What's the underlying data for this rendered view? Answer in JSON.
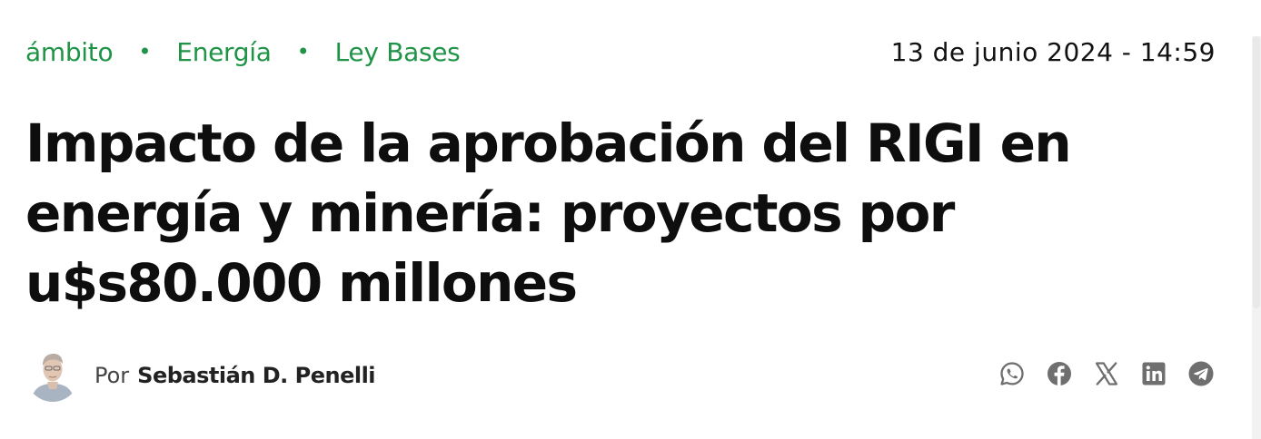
{
  "article": {
    "breadcrumb": [
      {
        "label": "ámbito"
      },
      {
        "label": "Energía"
      },
      {
        "label": "Ley Bases"
      }
    ],
    "breadcrumb_separator": "•",
    "date": "13 de junio 2024 - 14:59",
    "title": "Impacto de la aprobación del RIGI en energía y minería: proyectos por u$s80.000 millones",
    "author_prefix": "Por",
    "author_name": "Sebastián D. Penelli"
  },
  "share": {
    "icons": [
      "whatsapp-icon",
      "facebook-icon",
      "x-icon",
      "linkedin-icon",
      "telegram-icon"
    ],
    "icon_color": "#6f6f6f"
  },
  "colors": {
    "accent": "#1f9447",
    "text": "#111111"
  }
}
